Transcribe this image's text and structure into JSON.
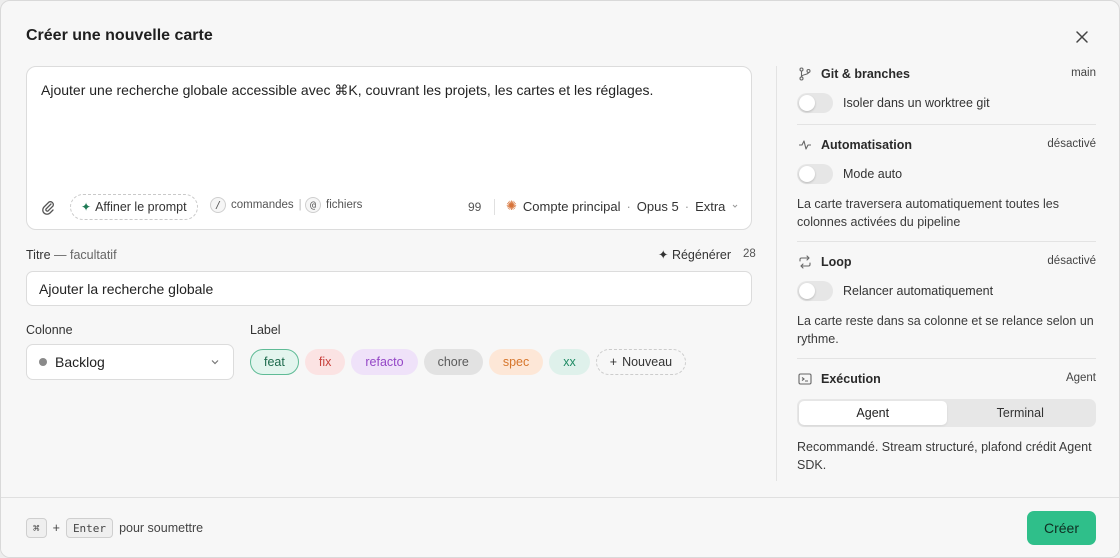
{
  "modal": {
    "title": "Créer une nouvelle carte"
  },
  "prompt": {
    "text": "Ajouter une recherche globale accessible avec ⌘K, couvrant les projets, les cartes et les réglages.",
    "refine_label": "Affiner le prompt",
    "commands_key": "/",
    "commands_label": "commandes",
    "files_key": "@",
    "files_label": "fichiers",
    "char_count": "99",
    "account": "Compte principal",
    "model": "Opus 5",
    "effort": "Extra"
  },
  "title_field": {
    "label": "Titre",
    "optional": "— facultatif",
    "regen_label": "Régénérer",
    "regen_count": "28",
    "value": "Ajouter la recherche globale"
  },
  "column": {
    "label": "Colonne",
    "value": "Backlog"
  },
  "labels": {
    "label": "Label",
    "items": [
      "feat",
      "fix",
      "refacto",
      "chore",
      "spec",
      "xx"
    ],
    "new_label": "Nouveau"
  },
  "panel": {
    "git": {
      "title": "Git & branches",
      "status": "main",
      "toggle_label": "Isoler dans un worktree git"
    },
    "auto": {
      "title": "Automatisation",
      "status": "désactivé",
      "toggle_label": "Mode auto",
      "desc": "La carte traversera automatiquement toutes les colonnes activées du pipeline"
    },
    "loop": {
      "title": "Loop",
      "status": "désactivé",
      "toggle_label": "Relancer automatiquement",
      "desc": "La carte reste dans sa colonne et se relance selon un rythme."
    },
    "exec": {
      "title": "Exécution",
      "status": "Agent",
      "options": [
        "Agent",
        "Terminal"
      ],
      "selected": "Agent",
      "desc": "Recommandé. Stream structuré, plafond crédit Agent SDK."
    }
  },
  "footer": {
    "key1": "⌘",
    "plus": "+",
    "key2": "Enter",
    "hint": "pour soumettre",
    "create_label": "Créer"
  },
  "colors": {
    "accent": "#2fbf8a",
    "feat": "#1d6a4c",
    "fix": "#c9423d",
    "refacto": "#9447c7",
    "spec": "#d6762c"
  }
}
